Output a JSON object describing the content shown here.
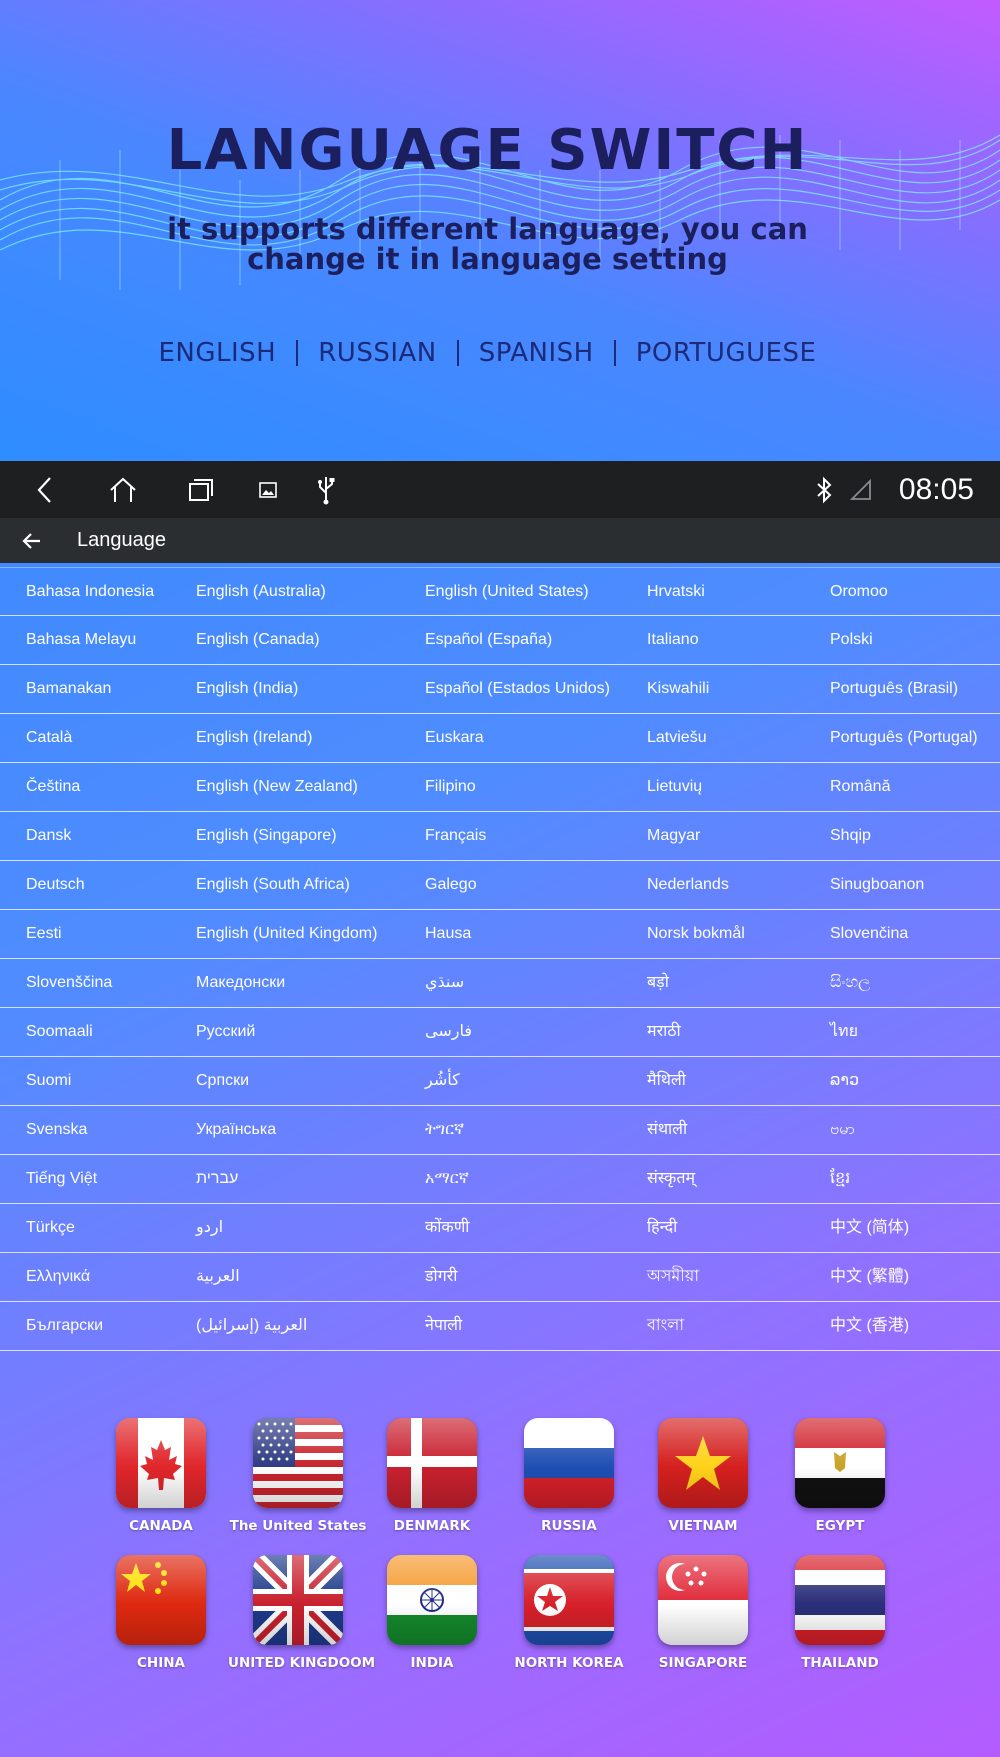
{
  "hero": {
    "title": "LANGUAGE SWITCH",
    "subtitle_line1": "it supports different language, you can",
    "subtitle_line2": "change it in language setting",
    "languages": [
      "ENGLISH",
      "RUSSIAN",
      "SPANISH",
      "PORTUGUESE"
    ]
  },
  "status_bar": {
    "icons": [
      "back-icon",
      "home-icon",
      "recent-apps-icon",
      "gallery-icon",
      "usb-icon",
      "bluetooth-icon",
      "signal-icon"
    ],
    "time": "08:05"
  },
  "app_bar": {
    "title": "Language"
  },
  "languages": {
    "rows": [
      [
        "Bahasa Indonesia",
        "English (Australia)",
        "English (United States)",
        "Hrvatski",
        "Oromoo"
      ],
      [
        "Bahasa Melayu",
        "English (Canada)",
        "Español (España)",
        "Italiano",
        "Polski"
      ],
      [
        "Bamanakan",
        "English (India)",
        "Español (Estados Unidos)",
        "Kiswahili",
        "Português (Brasil)"
      ],
      [
        "Català",
        "English (Ireland)",
        "Euskara",
        "Latviešu",
        "Português (Portugal)"
      ],
      [
        "Čeština",
        "English (New Zealand)",
        "Filipino",
        "Lietuvių",
        "Română"
      ],
      [
        "Dansk",
        "English (Singapore)",
        "Français",
        "Magyar",
        "Shqip"
      ],
      [
        "Deutsch",
        "English (South Africa)",
        "Galego",
        "Nederlands",
        "Sinugboanon"
      ],
      [
        "Eesti",
        "English (United Kingdom)",
        "Hausa",
        "Norsk bokmål",
        "Slovenčina"
      ],
      [
        "Slovenščina",
        "Македонски",
        "سنڌي",
        "बड़ो",
        "සිංහල"
      ],
      [
        "Soomaali",
        "Русский",
        "فارسی",
        "मराठी",
        "ไทย"
      ],
      [
        "Suomi",
        "Српски",
        "كأشُر",
        "मैथिली",
        "ລາວ"
      ],
      [
        "Svenska",
        "Українська",
        "ትግርኛ",
        "संथाली",
        "ဗမာ"
      ],
      [
        "Tiếng Việt",
        "עברית",
        "አማርኛ",
        "संस्कृतम्",
        "ខ្មែរ"
      ],
      [
        "Türkçe",
        "اردو",
        "कोंकणी",
        "हिन्दी",
        "中文 (简体)"
      ],
      [
        "Ελληνικά",
        "العربية",
        "डोगरी",
        "অসমীয়া",
        "中文 (繁體)"
      ],
      [
        "Български",
        "العربية (إسرائيل)",
        "नेपाली",
        "বাংলা",
        "中文 (香港)"
      ]
    ]
  },
  "flags": [
    {
      "label": "CANADA",
      "icon": "canada-flag-icon"
    },
    {
      "label": "The United States",
      "icon": "usa-flag-icon"
    },
    {
      "label": "DENMARK",
      "icon": "denmark-flag-icon"
    },
    {
      "label": "RUSSIA",
      "icon": "russia-flag-icon"
    },
    {
      "label": "VIETNAM",
      "icon": "vietnam-flag-icon"
    },
    {
      "label": "EGYPT",
      "icon": "egypt-flag-icon"
    },
    {
      "label": "CHINA",
      "icon": "china-flag-icon"
    },
    {
      "label": "UNITED KINGDOOM",
      "icon": "uk-flag-icon"
    },
    {
      "label": "INDIA",
      "icon": "india-flag-icon"
    },
    {
      "label": "NORTH KOREA",
      "icon": "north-korea-flag-icon"
    },
    {
      "label": "SINGAPORE",
      "icon": "singapore-flag-icon"
    },
    {
      "label": "THAILAND",
      "icon": "thailand-flag-icon"
    }
  ]
}
